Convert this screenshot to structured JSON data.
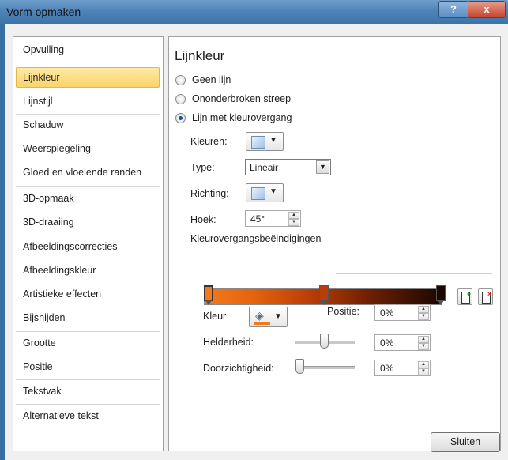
{
  "window": {
    "title": "Vorm opmaken",
    "help_label": "?",
    "close_label": "x"
  },
  "nav": {
    "items": [
      "Opvulling",
      "Lijnkleur",
      "Lijnstijl",
      "Schaduw",
      "Weerspiegeling",
      "Gloed en vloeiende randen",
      "3D-opmaak",
      "3D-draaiing",
      "Afbeeldingscorrecties",
      "Afbeeldingskleur",
      "Artistieke effecten",
      "Bijsnijden",
      "Grootte",
      "Positie",
      "Tekstvak",
      "Alternatieve tekst"
    ],
    "selected": "Lijnkleur"
  },
  "panel": {
    "title": "Lijnkleur",
    "options": [
      {
        "label": "Geen lijn",
        "checked": false
      },
      {
        "label": "Ononderbroken streep",
        "checked": false
      },
      {
        "label": "Lijn met kleurovergang",
        "checked": true
      }
    ],
    "colors_label": "Kleuren:",
    "type_label": "Type:",
    "type_value": "Lineair",
    "direction_label": "Richting:",
    "angle_label": "Hoek:",
    "angle_value": "45°",
    "stops_group_label": "Kleurovergangsbeëindigingen",
    "color_label": "Kleur",
    "position_label": "Positie:",
    "position_value": "0%",
    "brightness_label": "Helderheid:",
    "brightness_value": "0%",
    "transparency_label": "Doorzichtigheid:",
    "transparency_value": "0%"
  },
  "colors": {
    "gradient_start": "#f07a1c",
    "gradient_end": "#1a0800",
    "title_bar": "#4f84b8",
    "selected_nav": "#fbd46a"
  },
  "footer": {
    "close_label": "Sluiten"
  }
}
